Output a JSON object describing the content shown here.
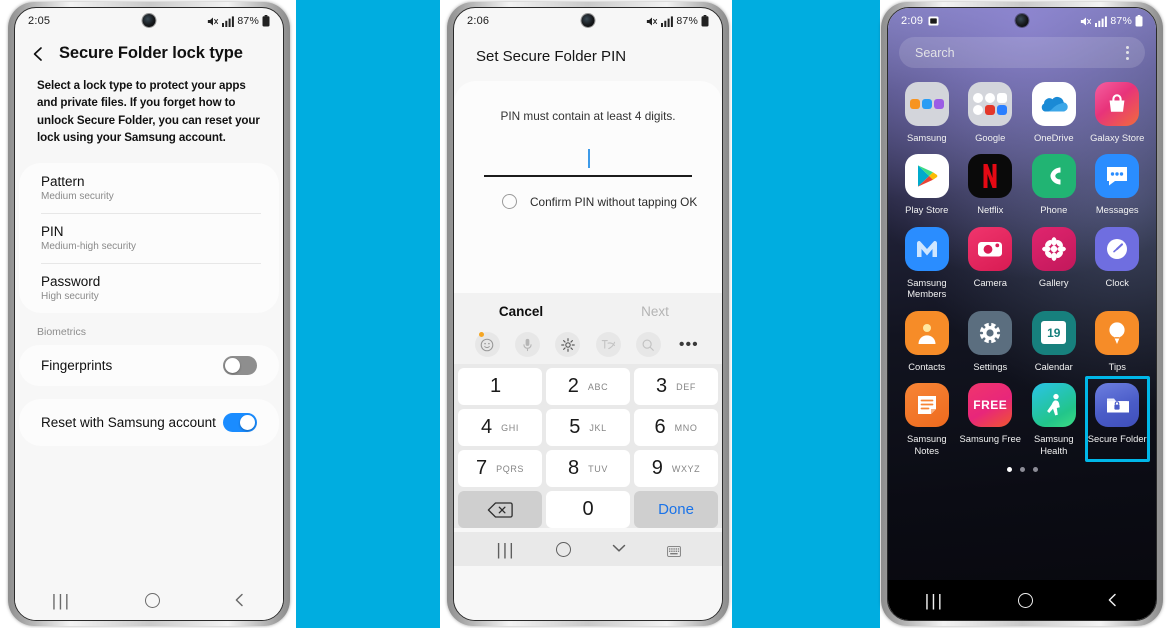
{
  "background_color": "#00ade0",
  "phone1": {
    "status": {
      "time": "2:05",
      "battery": "87%",
      "icons": [
        "mute-icon",
        "signal-icon",
        "battery-icon"
      ]
    },
    "title": "Secure Folder lock type",
    "description": "Select a lock type to protect your apps and private files. If you forget how to unlock Secure Folder, you can reset your lock using your Samsung account.",
    "lock_types": [
      {
        "title": "Pattern",
        "subtitle": "Medium security"
      },
      {
        "title": "PIN",
        "subtitle": "Medium-high security"
      },
      {
        "title": "Password",
        "subtitle": "High security"
      }
    ],
    "biometrics_label": "Biometrics",
    "fingerprints": {
      "label": "Fingerprints",
      "state": "off"
    },
    "reset_account": {
      "label": "Reset with Samsung account",
      "state": "on",
      "accent": "#1a8cff"
    },
    "navbar": [
      "recents",
      "home",
      "back"
    ]
  },
  "phone2": {
    "status": {
      "time": "2:06",
      "battery": "87%"
    },
    "title": "Set Secure Folder PIN",
    "hint": "PIN must contain at least 4 digits.",
    "pin_value": "",
    "confirm_option": {
      "label": "Confirm PIN without tapping OK",
      "state": "unchecked"
    },
    "actions": {
      "cancel": "Cancel",
      "next": "Next",
      "next_state": "disabled"
    },
    "keyboard_toolbar": [
      "emoji-icon",
      "microphone-icon",
      "settings-gear-icon",
      "handwriting-icon",
      "search-icon",
      "more-options-icon"
    ],
    "keypad": [
      [
        {
          "num": "1",
          "sub": ""
        },
        {
          "num": "2",
          "sub": "ABC"
        },
        {
          "num": "3",
          "sub": "DEF"
        }
      ],
      [
        {
          "num": "4",
          "sub": "GHI"
        },
        {
          "num": "5",
          "sub": "JKL"
        },
        {
          "num": "6",
          "sub": "MNO"
        }
      ],
      [
        {
          "num": "7",
          "sub": "PQRS"
        },
        {
          "num": "8",
          "sub": "TUV"
        },
        {
          "num": "9",
          "sub": "WXYZ"
        }
      ]
    ],
    "keypad_bottom": {
      "backspace": "backspace-icon",
      "zero": "0",
      "done": "Done",
      "done_color": "#1a73e8"
    },
    "navbar": [
      "recents",
      "home",
      "hide-keyboard",
      "keyboard-switch"
    ]
  },
  "phone3": {
    "status": {
      "time": "2:09",
      "battery": "87%"
    },
    "search": {
      "placeholder": "Search",
      "menu": "more-options-icon"
    },
    "apps": [
      [
        {
          "label": "Samsung",
          "icon": "samsung-folder-icon"
        },
        {
          "label": "Google",
          "icon": "google-folder-icon"
        },
        {
          "label": "OneDrive",
          "icon": "onedrive-icon"
        },
        {
          "label": "Galaxy Store",
          "icon": "galaxy-store-icon"
        }
      ],
      [
        {
          "label": "Play Store",
          "icon": "play-store-icon"
        },
        {
          "label": "Netflix",
          "icon": "netflix-icon"
        },
        {
          "label": "Phone",
          "icon": "phone-icon"
        },
        {
          "label": "Messages",
          "icon": "messages-icon"
        }
      ],
      [
        {
          "label": "Samsung Members",
          "icon": "samsung-members-icon"
        },
        {
          "label": "Camera",
          "icon": "camera-icon"
        },
        {
          "label": "Gallery",
          "icon": "gallery-icon"
        },
        {
          "label": "Clock",
          "icon": "clock-icon"
        }
      ],
      [
        {
          "label": "Contacts",
          "icon": "contacts-icon"
        },
        {
          "label": "Settings",
          "icon": "settings-gear-icon"
        },
        {
          "label": "Calendar",
          "icon": "calendar-icon",
          "day": "19"
        },
        {
          "label": "Tips",
          "icon": "tips-bulb-icon"
        }
      ],
      [
        {
          "label": "Samsung Notes",
          "icon": "samsung-notes-icon"
        },
        {
          "label": "Samsung Free",
          "icon": "samsung-free-icon",
          "text": "FREE"
        },
        {
          "label": "Samsung Health",
          "icon": "samsung-health-icon"
        },
        {
          "label": "Secure Folder",
          "icon": "secure-folder-icon",
          "highlighted": true
        }
      ]
    ],
    "page_dots": {
      "count": 3,
      "active_index": 0
    },
    "highlight_color": "#00b7e8",
    "navbar": [
      "recents",
      "home",
      "back"
    ]
  }
}
